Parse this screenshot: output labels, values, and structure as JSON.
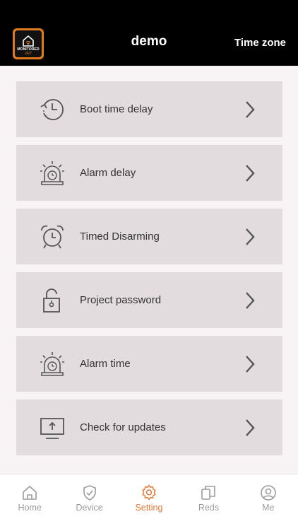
{
  "header": {
    "title": "demo",
    "right_action": "Time zone",
    "logo": {
      "line1": "MONITORED",
      "line2": "24/7",
      "icon": "house-wifi-icon"
    }
  },
  "settings": [
    {
      "label": "Boot time delay",
      "icon": "clock-delay-icon"
    },
    {
      "label": "Alarm delay",
      "icon": "alarm-siren-icon"
    },
    {
      "label": "Timed Disarming",
      "icon": "alarm-clock-icon"
    },
    {
      "label": "Project password",
      "icon": "padlock-icon"
    },
    {
      "label": "Alarm time",
      "icon": "alarm-siren-icon"
    },
    {
      "label": "Check for updates",
      "icon": "monitor-upload-icon"
    }
  ],
  "tabs": [
    {
      "label": "Home",
      "icon": "home-icon",
      "active": false
    },
    {
      "label": "Device",
      "icon": "shield-check-icon",
      "active": false
    },
    {
      "label": "Setting",
      "icon": "gear-icon",
      "active": true
    },
    {
      "label": "Reds",
      "icon": "devices-icon",
      "active": false
    },
    {
      "label": "Me",
      "icon": "user-circle-icon",
      "active": false
    }
  ],
  "colors": {
    "header_bg": "#000000",
    "accent": "#e07a38",
    "item_bg": "#e2dcdf",
    "page_bg": "#f8f4f6",
    "tab_inactive": "#9b9b9b"
  }
}
